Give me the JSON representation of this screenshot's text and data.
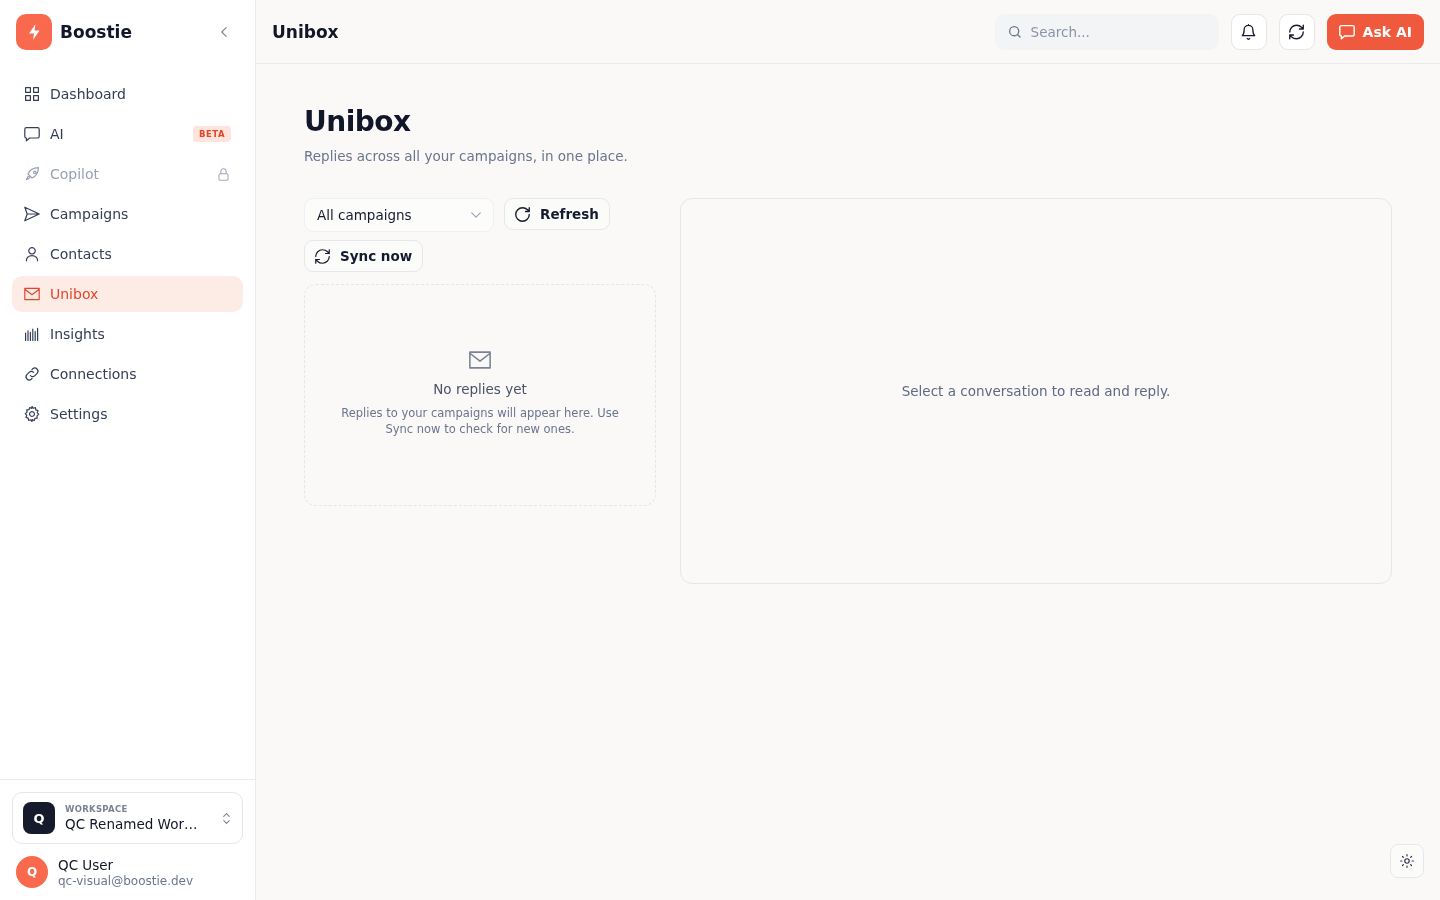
{
  "sidebar": {
    "brand": "Boostie",
    "nav_items": [
      {
        "label": "Dashboard",
        "selected": false,
        "locked": false
      },
      {
        "label": "AI",
        "selected": false,
        "locked": false,
        "badge": "BETA"
      },
      {
        "label": "Copilot",
        "selected": false,
        "locked": true
      },
      {
        "label": "Campaigns",
        "selected": false,
        "locked": false
      },
      {
        "label": "Contacts",
        "selected": false,
        "locked": false
      },
      {
        "label": "Unibox",
        "selected": true,
        "locked": false
      },
      {
        "label": "Insights",
        "selected": false,
        "locked": false
      },
      {
        "label": "Connections",
        "selected": false,
        "locked": false
      },
      {
        "label": "Settings",
        "selected": false,
        "locked": false
      }
    ],
    "workspace": {
      "label": "WORKSPACE",
      "avatar": "Q",
      "name": "QC Renamed Wor…"
    },
    "user": {
      "avatar": "Q",
      "name": "QC User",
      "email": "qc-visual@boostie.dev"
    }
  },
  "header": {
    "title": "Unibox",
    "search": {
      "placeholder": "Search..."
    },
    "ask_ai_button": "Ask AI"
  },
  "page": {
    "title": "Unibox",
    "subtitle": "Replies across all your campaigns, in one place.",
    "campaign_select": {
      "value": "All campaigns"
    },
    "refresh_button": "Refresh",
    "sync_button": "Sync now",
    "empty_state": {
      "title": "No replies yet",
      "text": "Replies to your campaigns will appear here. Use Sync now to check for new ones."
    },
    "conversation_message": "Select a conversation to read and reply."
  }
}
